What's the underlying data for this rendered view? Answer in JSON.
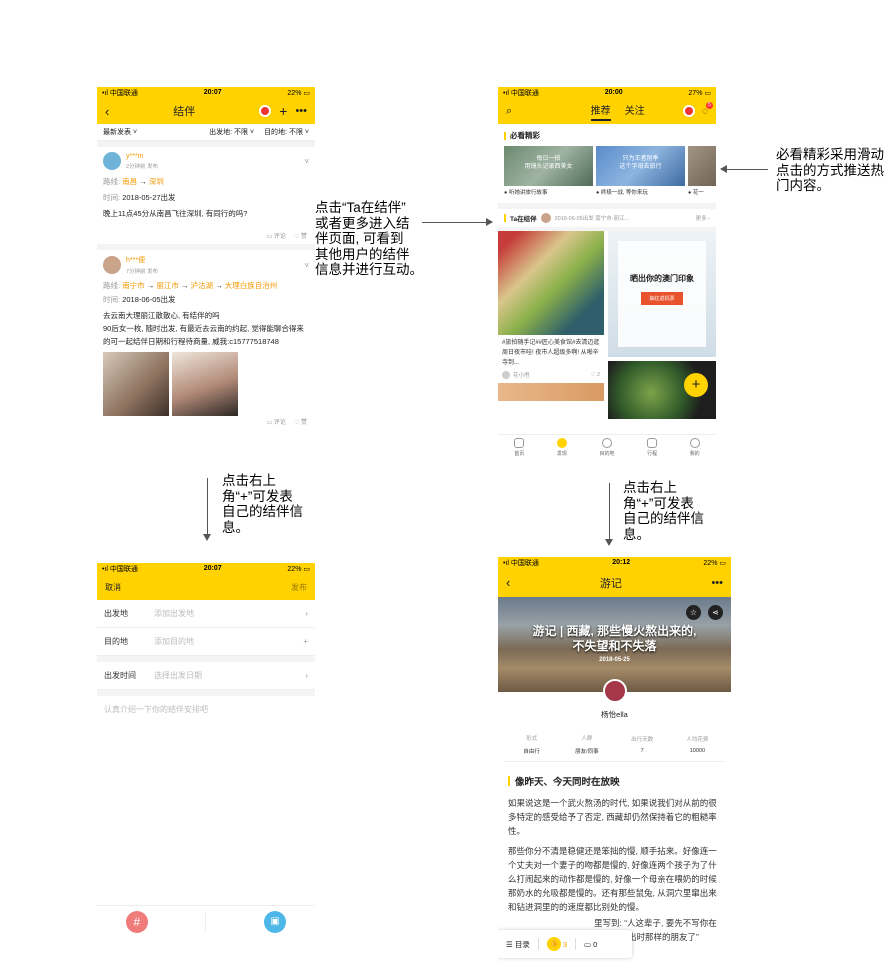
{
  "screen1": {
    "status": {
      "carrier": "中国联通",
      "time": "20:07",
      "battery": "22%"
    },
    "nav": {
      "title": "结伴"
    },
    "filters": {
      "sort": "最新发表",
      "depart": "出发地: 不限",
      "dest": "目的地: 不限"
    },
    "posts": [
      {
        "user": "y***m",
        "time": "2分钟前 发布",
        "route_label": "路线:",
        "route": [
          "南昌",
          "深圳"
        ],
        "date_label": "时间:",
        "date": "2018-05-27出发",
        "text": "晚上11点45分从南昌飞往深圳, 有同行的吗?",
        "comment": "评论",
        "like": "赞"
      },
      {
        "user": "h***便",
        "time": "7分钟前 发布",
        "route_label": "路线:",
        "route": [
          "南宁市",
          "丽江市",
          "泸沽湖",
          "大理白族自治州"
        ],
        "date_label": "时间:",
        "date": "2018-06-05出发",
        "text": "去云南大理丽江散散心, 有结伴的吗\n90后女一枚, 随时出发, 有最近去云南的约起, 觉得能聊合得来的可一起结伴日期和行程待商量, 威我:c15777518748",
        "comment": "评论",
        "like": "赞"
      }
    ]
  },
  "annotations": {
    "middle": "点击“Ta在结伴”\n或者更多进入结\n伴页面, 可看到\n其他用户的结伴\n信息并进行互动。",
    "right": "必看精彩采用滑动\n点击的方式推送热\n门内容。",
    "down_left": "点击右上\n角“+”可发表\n自己的结伴信\n息。",
    "down_right": "点击右上\n角“+”可发表\n自己的结伴信\n息。"
  },
  "screen2": {
    "status": {
      "carrier": "中国联通",
      "time": "20:00",
      "battery": "27%"
    },
    "tabs": [
      "推荐",
      "关注"
    ],
    "badge": "5",
    "section_title": "必看精彩",
    "highlights": [
      {
        "img_text": "每日一拍\n用镜头记录西美女",
        "caption": "听她讲旅行故事"
      },
      {
        "img_text": "只为王者别季\n这个字母去旅行",
        "caption": "终极一战, 等你来玩"
      },
      {
        "img_text": "",
        "caption": "花一"
      }
    ],
    "ta_title": "Ta在结伴",
    "ta_info": "2018-06-05出发 南宁市-丽江...",
    "ta_more": "更多",
    "feed_card": {
      "text": "#旅拍随手记##匠心美食馆#去清迈逛周日夜市哇! 夜市人超级多啊! 从啪辛寺到...",
      "user": "花小甩",
      "likes": "2"
    },
    "promo": {
      "title": "晒出你的澳门印象",
      "button": "抽往返机票"
    },
    "bottom_tabs": [
      "首页",
      "发现",
      "目的地",
      "行程",
      "我的"
    ]
  },
  "screen3": {
    "status": {
      "carrier": "中国联通",
      "time": "20:07",
      "battery": "22%"
    },
    "cancel": "取消",
    "publish": "发布",
    "rows": [
      {
        "label": "出发地",
        "placeholder": "添加出发地"
      },
      {
        "label": "目的地",
        "placeholder": "添加目的地"
      },
      {
        "label": "出发时间",
        "placeholder": "选择出发日期"
      }
    ],
    "intro_placeholder": "认真介绍一下你的结伴安排吧"
  },
  "screen4": {
    "status": {
      "carrier": "中国联通",
      "time": "20:12",
      "battery": "22%"
    },
    "nav": {
      "title": "游记"
    },
    "hero": {
      "title": "游记 | 西藏, 那些慢火熬出来的,\n不失望和不失落",
      "date": "2018-05-25"
    },
    "author": "杨怡ella",
    "stats": [
      {
        "label": "形式",
        "value": "自由行"
      },
      {
        "label": "人群",
        "value": "朋友/同事"
      },
      {
        "label": "出行天数",
        "value": "7"
      },
      {
        "label": "人均花费",
        "value": "10000"
      }
    ],
    "section": "像昨天、今天同时在放映",
    "para1": "如果说这是一个武火熬汤的时代, 如果说我们对从前的很多特定的感受给予了否定, 西藏却仍然保持着它的粗糙率性。",
    "para2": "那些你分不清是稳健还是笨拙的慢, 顺手拈来。好像连一个丈夫对一个妻子的吻都是慢的, 好像连两个孩子为了什么打闹起来的动作都是慢的, 好像一个母亲在喂奶的时候那奶水的允吸都是慢的。还有那些鼠兔, 从洞穴里窜出来和钻进洞里的的速度都比别处的慢。",
    "para3": "里写到: “人这辈子, 要先不写你在到像人三出时那样的朋友了”",
    "bottom": {
      "toc": "目录",
      "likes": "3",
      "comments": "0"
    }
  }
}
